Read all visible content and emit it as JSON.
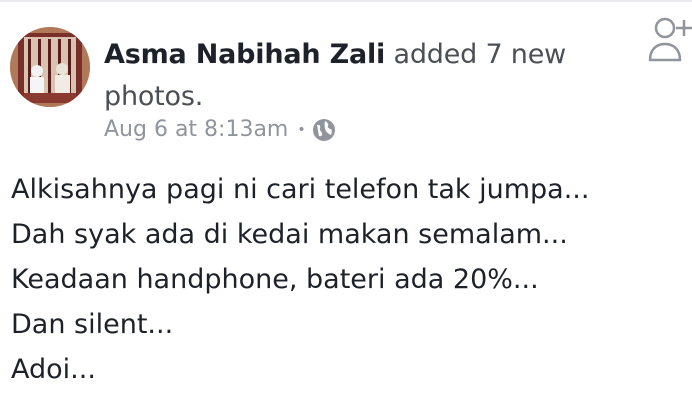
{
  "post": {
    "author": "Asma Nabihah Zali",
    "action": "added 7 new photos.",
    "timestamp": "Aug 6 at 8:13am",
    "separator": "•",
    "privacy_icon": "globe-icon",
    "lines": [
      "Alkisahnya pagi ni cari telefon tak jumpa...",
      "Dah syak ada di kedai makan semalam...",
      "Keadaan handphone, bateri ada 20%...",
      "Dan silent...",
      "Adoi..."
    ]
  },
  "header_action": {
    "icon": "add-friend-icon"
  },
  "colors": {
    "text": "#1d2129",
    "secondary": "#90949c",
    "action": "#4b4f56"
  }
}
